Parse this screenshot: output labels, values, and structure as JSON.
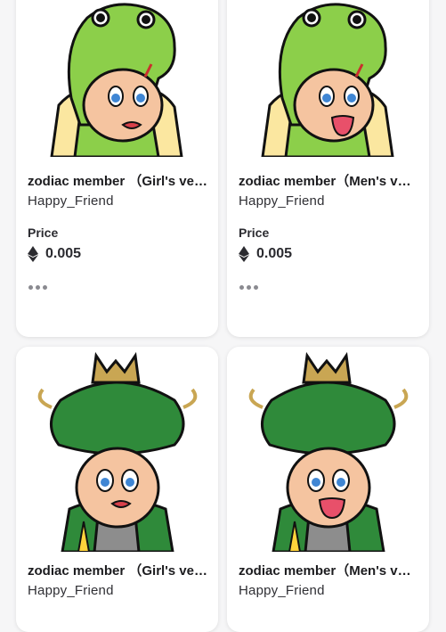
{
  "cards": [
    {
      "title": "zodiac member （Girl's ve…",
      "creator": "Happy_Friend",
      "price_label": "Price",
      "price_value": "0.005",
      "price_icon": "ethereum-icon",
      "more_icon": "more-dots-icon",
      "art": "frog-girl"
    },
    {
      "title": "zodiac member（Men's v…",
      "creator": "Happy_Friend",
      "price_label": "Price",
      "price_value": "0.005",
      "price_icon": "ethereum-icon",
      "more_icon": "more-dots-icon",
      "art": "frog-boy"
    },
    {
      "title": "zodiac member （Girl's ve…",
      "creator": "Happy_Friend",
      "art": "dragon-girl"
    },
    {
      "title": "zodiac member（Men's v…",
      "creator": "Happy_Friend",
      "art": "dragon-boy"
    }
  ],
  "colors": {
    "card_bg": "#ffffff",
    "page_bg": "#f6f6f7",
    "frog_green": "#8ccf4a",
    "dragon_green": "#2f8a3a",
    "skin": "#f5c4a0"
  }
}
